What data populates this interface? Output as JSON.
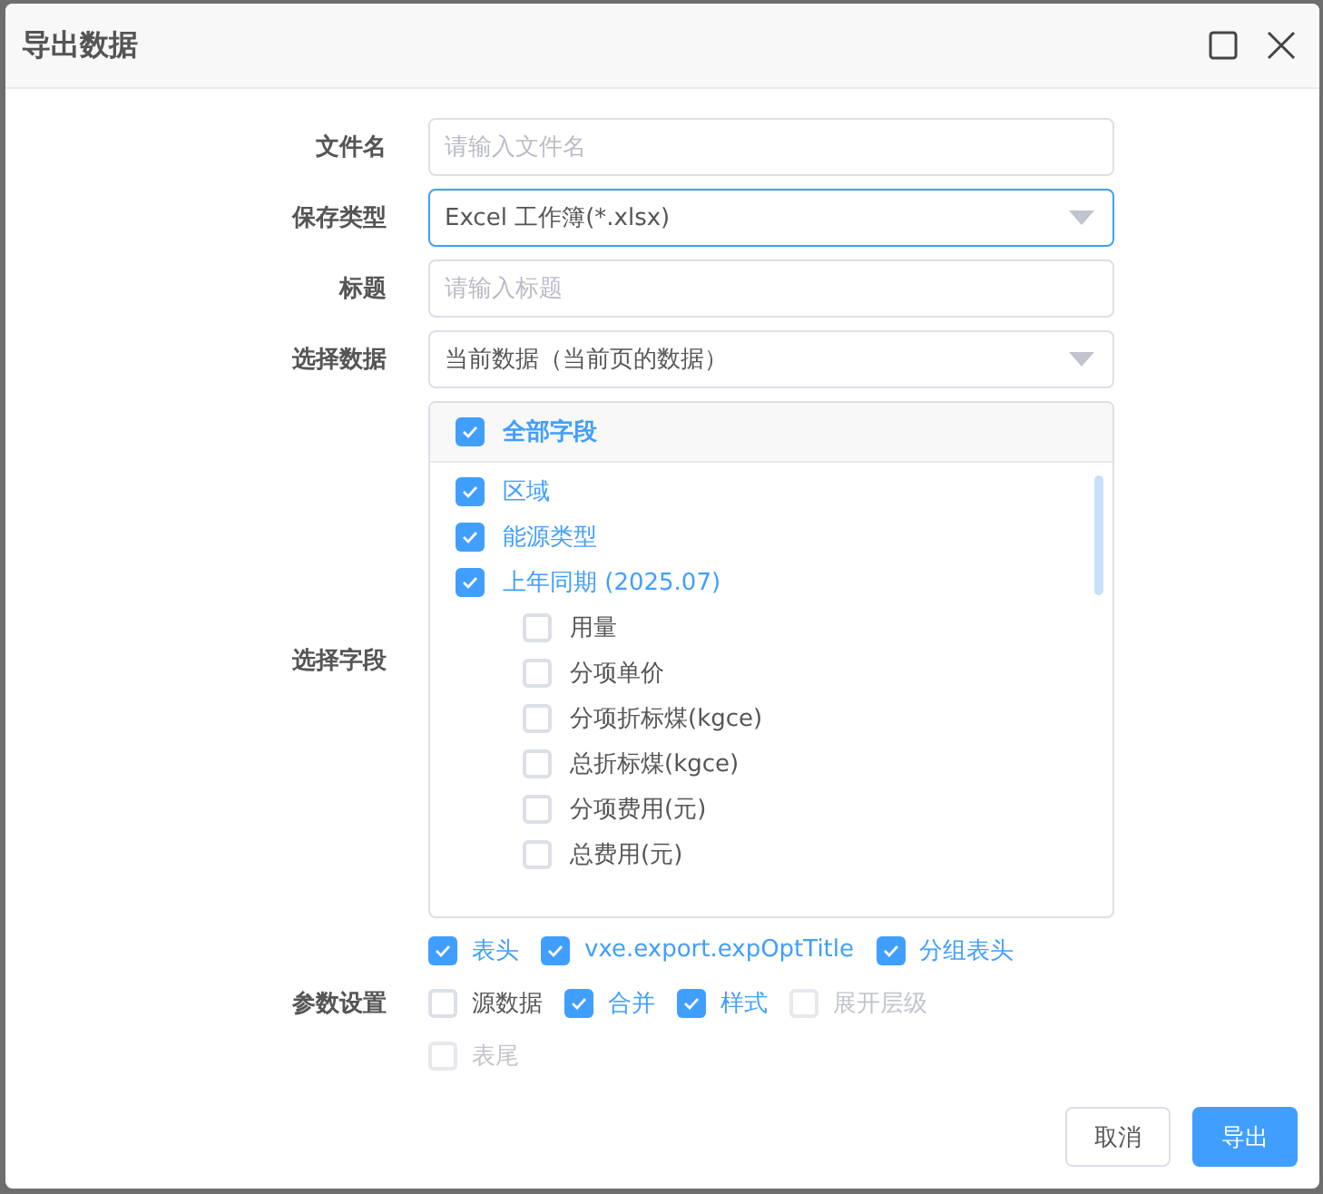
{
  "dialog": {
    "title": "导出数据"
  },
  "form": {
    "filename": {
      "label": "文件名",
      "placeholder": "请输入文件名"
    },
    "type": {
      "label": "保存类型",
      "value": "Excel 工作簿(*.xlsx)",
      "focused": true
    },
    "title": {
      "label": "标题",
      "placeholder": "请输入标题"
    },
    "data": {
      "label": "选择数据",
      "value": "当前数据（当前页的数据）",
      "focused": false
    },
    "fields": {
      "label": "选择字段",
      "all": {
        "label": "全部字段",
        "checked": true
      },
      "items": [
        {
          "label": "区域",
          "checked": true
        },
        {
          "label": "能源类型",
          "checked": true
        },
        {
          "label": "上年同期 (2025.07)",
          "checked": true,
          "children": [
            {
              "label": "用量",
              "checked": false
            },
            {
              "label": "分项单价",
              "checked": false
            },
            {
              "label": "分项折标煤(kgce)",
              "checked": false
            },
            {
              "label": "总折标煤(kgce)",
              "checked": false
            },
            {
              "label": "分项费用(元)",
              "checked": false
            },
            {
              "label": "总费用(元)",
              "checked": false
            }
          ]
        }
      ]
    },
    "options": {
      "label": "参数设置",
      "groups": [
        {
          "items": [
            {
              "label": "表头",
              "checked": true,
              "disabled": false
            },
            {
              "label": "vxe.export.expOptTitle",
              "checked": true,
              "disabled": false
            },
            {
              "label": "分组表头",
              "checked": true,
              "disabled": false
            }
          ]
        },
        {
          "items": [
            {
              "label": "源数据",
              "checked": false,
              "disabled": false
            },
            {
              "label": "合并",
              "checked": true,
              "disabled": false
            },
            {
              "label": "样式",
              "checked": true,
              "disabled": false
            },
            {
              "label": "展开层级",
              "checked": false,
              "disabled": true
            }
          ]
        },
        {
          "items": [
            {
              "label": "表尾",
              "checked": false,
              "disabled": true
            }
          ]
        }
      ]
    }
  },
  "buttons": [
    {
      "label": "取消",
      "kind": "default"
    },
    {
      "label": "导出",
      "kind": "primary"
    }
  ]
}
